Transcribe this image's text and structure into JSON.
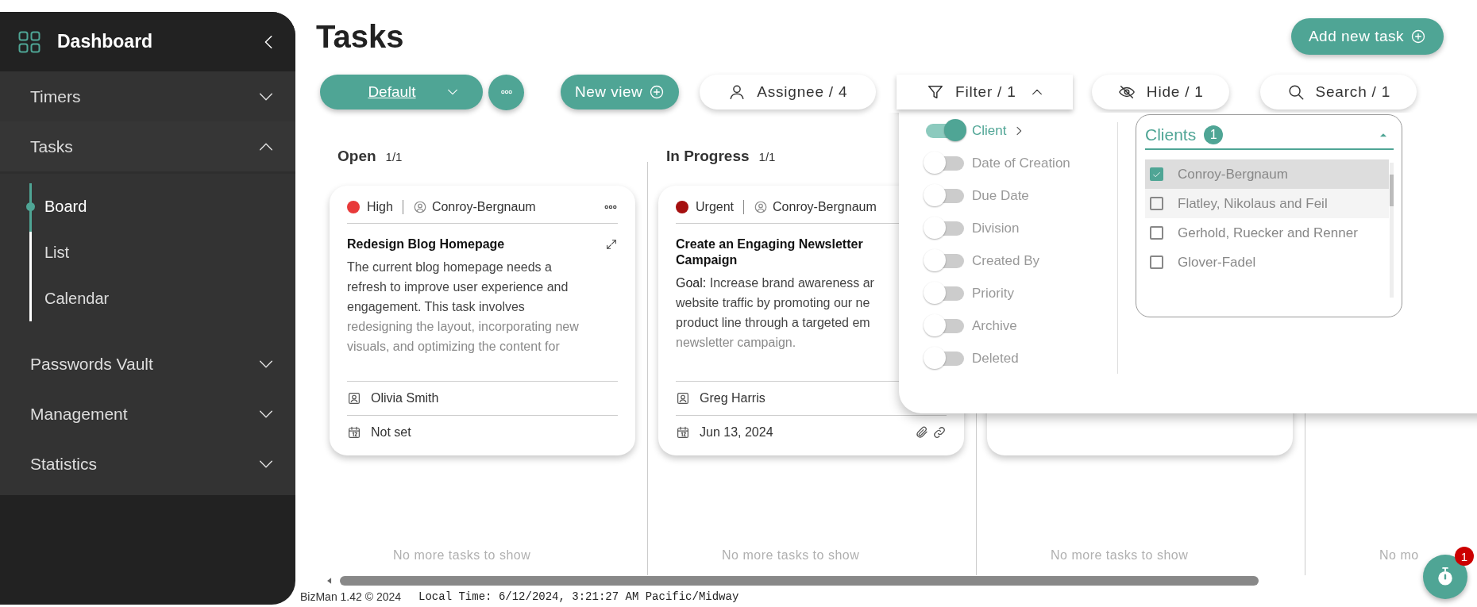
{
  "sidebar": {
    "title": "Dashboard",
    "items": [
      {
        "label": "Timers",
        "expanded": false
      },
      {
        "label": "Tasks",
        "expanded": true,
        "children": [
          {
            "label": "Board",
            "selected": true
          },
          {
            "label": "List",
            "selected": false
          },
          {
            "label": "Calendar",
            "selected": false
          }
        ]
      },
      {
        "label": "Passwords Vault",
        "expanded": false
      },
      {
        "label": "Management",
        "expanded": false
      },
      {
        "label": "Statistics",
        "expanded": false
      }
    ]
  },
  "page_title": "Tasks",
  "add_button": "Add new task",
  "toolbar": [
    {
      "kind": "view",
      "label": "Default"
    },
    {
      "kind": "more"
    },
    {
      "kind": "new",
      "label": "New view"
    },
    {
      "kind": "assignee",
      "label": "Assignee / 4"
    },
    {
      "kind": "filter",
      "label": "Filter / 1",
      "expanded": true
    },
    {
      "kind": "hide",
      "label": "Hide / 1"
    },
    {
      "kind": "search",
      "label": "Search / 1"
    }
  ],
  "columns": [
    {
      "title": "Open",
      "count": "1/1",
      "cards": [
        {
          "kind": "task",
          "priority": "High",
          "color": "#e83a3a",
          "client": "Conroy-Bergnaum",
          "title": "Redesign Blog Homepage",
          "lines": [
            "The current blog homepage needs a",
            "refresh to improve user experience and",
            "engagement. This task involves",
            "redesigning the layout, incorporating new",
            "visuals, and optimizing the content for"
          ],
          "assignee": "Olivia Smith",
          "date": "Not set",
          "attachments": false
        }
      ],
      "empty_text": "No more tasks to show"
    },
    {
      "title": "In Progress",
      "count": "1/1",
      "cards": [
        {
          "kind": "task",
          "priority": "Urgent",
          "color": "#a50f0f",
          "client": "Conroy-Bergnaum",
          "title": "Create an Engaging Newsletter Campaign",
          "lines": [
            "**Goal:** Increase brand awareness ar",
            "website traffic by promoting our ne",
            "product line through a targeted em",
            "newsletter campaign."
          ],
          "assignee": "Greg Harris",
          "date": "Jun 13, 2024",
          "attachments": true
        }
      ],
      "empty_text": "No more tasks to show"
    },
    {
      "cards": [
        {
          "kind": "covered"
        }
      ],
      "empty_text": "No more tasks to show"
    },
    {
      "empty_text": "No mo"
    }
  ],
  "filter_menu": {
    "fields": [
      {
        "label": "Client",
        "on": true,
        "submenu": true
      },
      {
        "label": "Date of Creation",
        "on": false
      },
      {
        "label": "Due Date",
        "on": false
      },
      {
        "label": "Division",
        "on": false
      },
      {
        "label": "Created By",
        "on": false
      },
      {
        "label": "Priority",
        "on": false
      },
      {
        "label": "Archive",
        "on": false
      },
      {
        "label": "Deleted",
        "on": false
      }
    ],
    "clients": {
      "label": "Clients",
      "count": "1",
      "expanded": true,
      "options": [
        {
          "label": "Conroy-Bergnaum",
          "checked": true
        },
        {
          "label": "Flatley, Nikolaus and Feil",
          "checked": false
        },
        {
          "label": "Gerhold, Ruecker and Renner",
          "checked": false
        },
        {
          "label": "Glover-Fadel",
          "checked": false
        }
      ]
    }
  },
  "footer": {
    "version": "BizMan 1.42 © 2024",
    "local_time": "Local Time: 6/12/2024, 3:21:27 AM Pacific/Midway"
  },
  "timer_badge": "1"
}
